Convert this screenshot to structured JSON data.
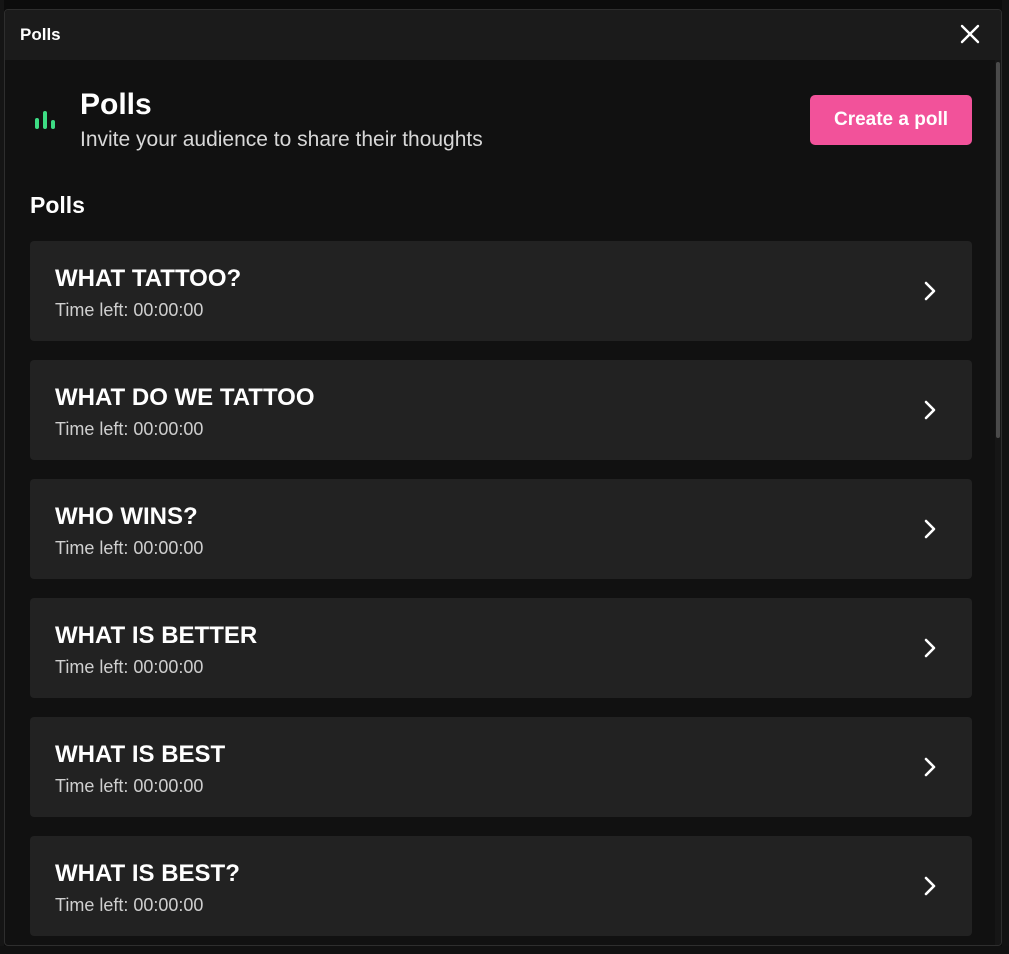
{
  "window": {
    "title": "Polls",
    "close_icon": "close-icon"
  },
  "header": {
    "icon": "bar-chart-icon",
    "title": "Polls",
    "subtitle": "Invite your audience to share their thoughts",
    "create_button_label": "Create a poll"
  },
  "section": {
    "title": "Polls"
  },
  "polls": [
    {
      "title": "WHAT TATTOO?",
      "time_left": "Time left: 00:00:00"
    },
    {
      "title": "WHAT DO WE TATTOO",
      "time_left": "Time left: 00:00:00"
    },
    {
      "title": "WHO WINS?",
      "time_left": "Time left: 00:00:00"
    },
    {
      "title": "WHAT IS BETTER",
      "time_left": "Time left: 00:00:00"
    },
    {
      "title": "WHAT IS BEST",
      "time_left": "Time left: 00:00:00"
    },
    {
      "title": "WHAT IS BEST?",
      "time_left": "Time left: 00:00:00"
    }
  ],
  "colors": {
    "accent": "#f2529a",
    "icon_green": "#3ddc84",
    "card_bg": "#222222",
    "modal_bg": "#111111",
    "titlebar_bg": "#1b1b1b"
  }
}
